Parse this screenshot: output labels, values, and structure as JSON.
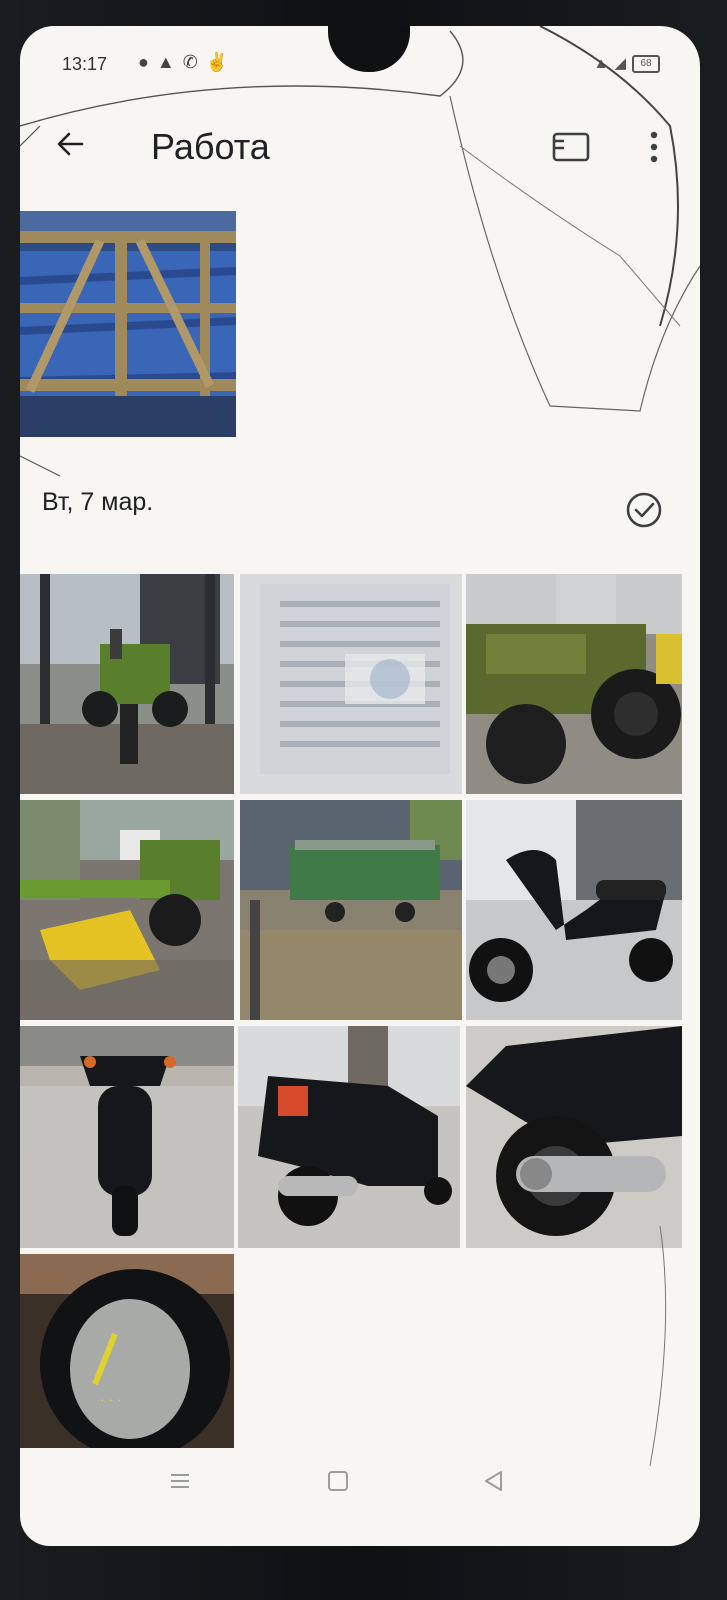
{
  "status_bar": {
    "time": "13:17",
    "left_icons": [
      "chat-icon",
      "user-icon",
      "call-icon",
      "hand-icon"
    ],
    "battery_level": "68"
  },
  "app_bar": {
    "title": "Работа",
    "back_icon": "arrow-left-icon",
    "slideshow_icon": "slideshow-icon",
    "more_icon": "more-vert-icon"
  },
  "section": {
    "date_label": "Вт, 7 мар.",
    "select_icon": "check-circle-icon"
  },
  "photos": [
    {
      "id": "wooden-crate",
      "desc": "crate"
    },
    {
      "id": "green-tractor-yard",
      "desc": "tractor"
    },
    {
      "id": "document-blurred",
      "desc": "document"
    },
    {
      "id": "tractor-wheels",
      "desc": "tractor"
    },
    {
      "id": "tractor-tiller",
      "desc": "tiller"
    },
    {
      "id": "green-trailer",
      "desc": "trailer"
    },
    {
      "id": "black-scooter-side",
      "desc": "scooter"
    },
    {
      "id": "black-scooter-front",
      "desc": "scooter"
    },
    {
      "id": "black-scooter-rear",
      "desc": "scooter"
    },
    {
      "id": "scooter-exhaust",
      "desc": "scooter"
    },
    {
      "id": "scooter-speedometer",
      "desc": "speedometer"
    }
  ],
  "nav_bar": {
    "icons": [
      "menu-icon",
      "home-icon",
      "back-triangle-icon"
    ]
  },
  "colors": {
    "tractor_green": "#5a7f2c",
    "tiller_yellow": "#e4c224",
    "scooter_black": "#15171a"
  }
}
